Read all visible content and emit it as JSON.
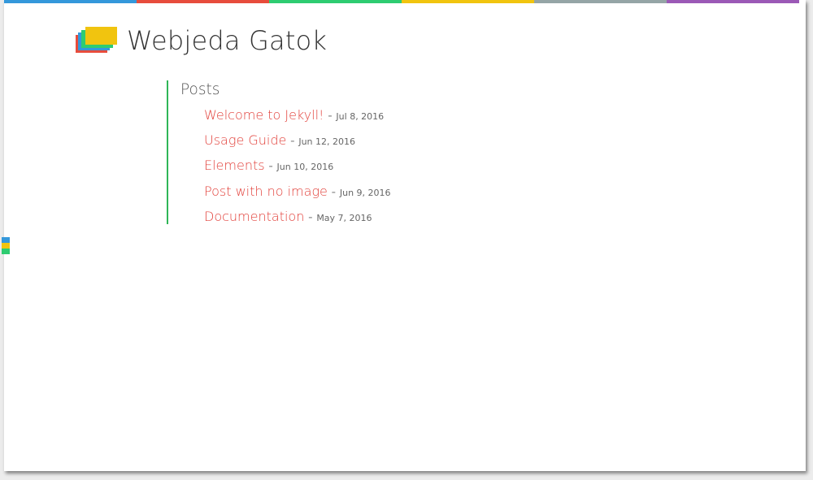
{
  "colors": {
    "bar": [
      "#3498db",
      "#e74c3c",
      "#2ecc71",
      "#f1c40f",
      "#95a5a6",
      "#9b59b6"
    ],
    "logo_layers": [
      "#e74c3c",
      "#3498db",
      "#2ecc71",
      "#f1c40f"
    ],
    "link": "#e2403a",
    "divider": "#2fb657"
  },
  "header": {
    "site_title": "Webjeda Gatok",
    "logo_icon": "stacked-cards-logo-icon"
  },
  "posts": {
    "heading": "Posts",
    "separator": "-",
    "items": [
      {
        "title": "Welcome to Jekyll!",
        "date": "Jul 8, 2016"
      },
      {
        "title": "Usage Guide",
        "date": "Jun 12, 2016"
      },
      {
        "title": "Elements",
        "date": "Jun 10, 2016"
      },
      {
        "title": "Post with no image",
        "date": "Jun 9, 2016"
      },
      {
        "title": "Documentation",
        "date": "May 7, 2016"
      }
    ]
  },
  "side_tab": {
    "icon": "color-tab-icon",
    "colors": [
      "#3498db",
      "#f1c40f",
      "#2ecc71"
    ]
  }
}
